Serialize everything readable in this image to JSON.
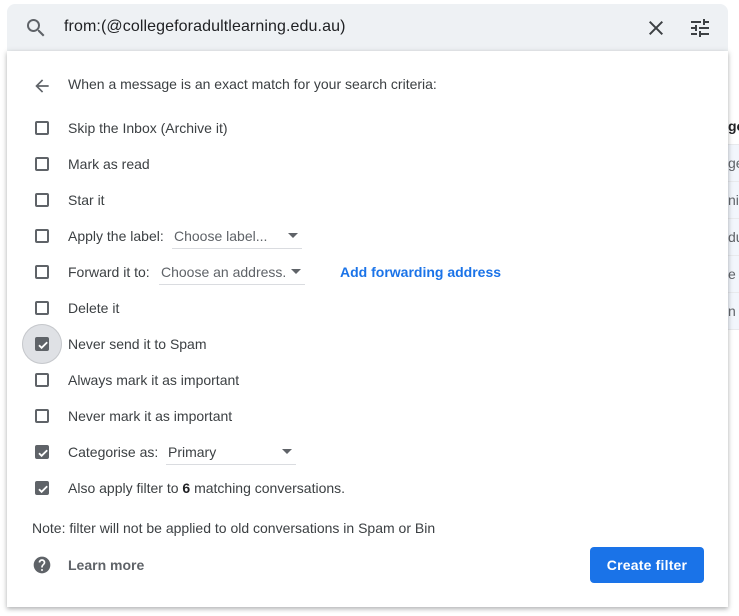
{
  "search": {
    "query": "from:(@collegeforadultlearning.edu.au)"
  },
  "background_list": [
    "go",
    "ge",
    "nic",
    "du",
    "e r",
    "n"
  ],
  "panel": {
    "header": "When a message is an exact match for your search criteria:",
    "options": [
      {
        "label": "Skip the Inbox (Archive it)",
        "checked": false
      },
      {
        "label": "Mark as read",
        "checked": false
      },
      {
        "label": "Star it",
        "checked": false
      },
      {
        "label": "Apply the label:",
        "checked": false,
        "select": "Choose label..."
      },
      {
        "label": "Forward it to:",
        "checked": false,
        "select": "Choose an address.",
        "link": "Add forwarding address"
      },
      {
        "label": "Delete it",
        "checked": false
      },
      {
        "label": "Never send it to Spam",
        "checked": true,
        "focused": true
      },
      {
        "label": "Always mark it as important",
        "checked": false
      },
      {
        "label": "Never mark it as important",
        "checked": false
      },
      {
        "label": "Categorise as:",
        "checked": true,
        "select": "Primary"
      },
      {
        "label_prefix": "Also apply filter to ",
        "label_count": "6",
        "label_suffix": " matching conversations.",
        "checked": true
      }
    ],
    "note": "Note: filter will not be applied to old conversations in Spam or Bin",
    "learn_more": "Learn more",
    "create_button": "Create filter"
  },
  "colors": {
    "accent": "#1a73e8",
    "checkbox": "#5f6368",
    "search_bg": "#eef1f4"
  },
  "icons": [
    "search-icon",
    "close-icon",
    "tune-icon",
    "arrow-back-icon",
    "help-icon",
    "checkmark-icon"
  ]
}
